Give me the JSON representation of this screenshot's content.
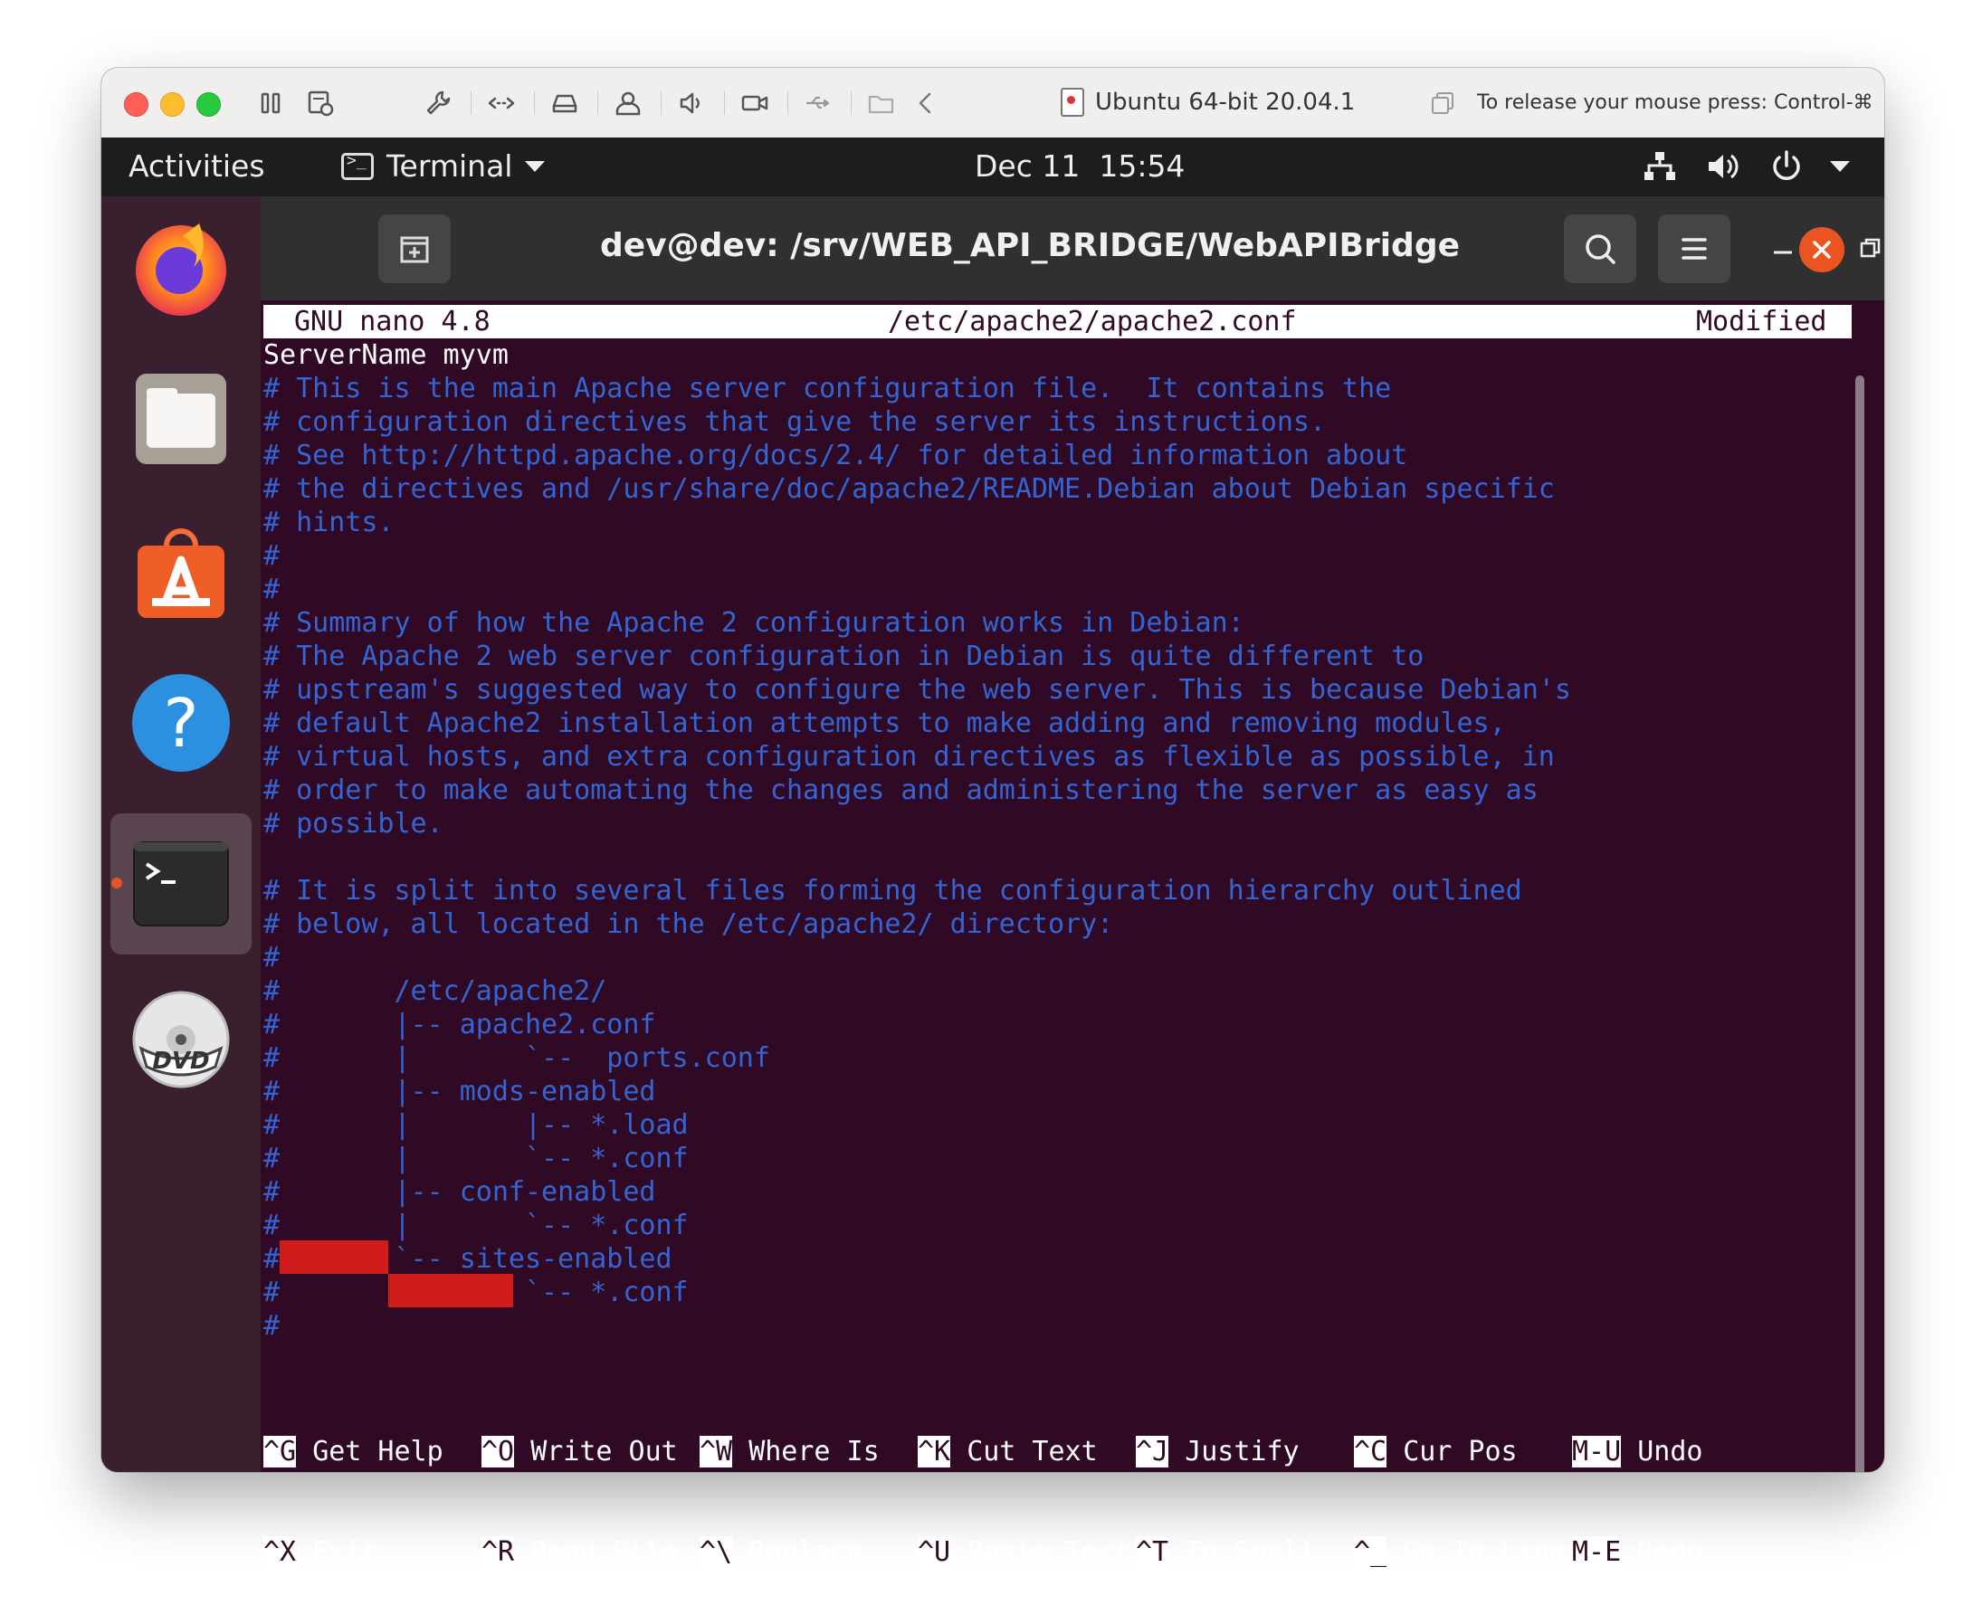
{
  "host": {
    "vm_title": "Ubuntu 64-bit 20.04.1",
    "release_hint": "To release your mouse press: Control-⌘",
    "toolbar_icons": [
      "pause-icon",
      "snapshot-icon",
      "settings-wrench-icon",
      "network-arrows-icon",
      "disk-icon",
      "user-icon",
      "speaker-icon",
      "camera-icon",
      "usb-icon",
      "shared-folder-icon",
      "back-arrow-icon"
    ]
  },
  "topbar": {
    "activities": "Activities",
    "app_name": "Terminal",
    "date": "Dec 11",
    "time": "15:54"
  },
  "dock": {
    "apps": [
      "firefox",
      "files",
      "ubuntu-software",
      "help",
      "terminal",
      "dvd"
    ],
    "active": "terminal"
  },
  "terminal": {
    "title": "dev@dev: /srv/WEB_API_BRIDGE/WebAPIBridge"
  },
  "nano": {
    "version": "GNU nano 4.8",
    "filename": "/etc/apache2/apache2.conf",
    "status": "Modified",
    "lines": [
      {
        "text": "ServerName myvm",
        "kind": "plain"
      },
      {
        "text": "# This is the main Apache server configuration file.  It contains the",
        "kind": "comment"
      },
      {
        "text": "# configuration directives that give the server its instructions.",
        "kind": "comment"
      },
      {
        "text": "# See http://httpd.apache.org/docs/2.4/ for detailed information about",
        "kind": "comment"
      },
      {
        "text": "# the directives and /usr/share/doc/apache2/README.Debian about Debian specific",
        "kind": "comment"
      },
      {
        "text": "# hints.",
        "kind": "comment"
      },
      {
        "text": "#",
        "kind": "comment"
      },
      {
        "text": "#",
        "kind": "comment"
      },
      {
        "text": "# Summary of how the Apache 2 configuration works in Debian:",
        "kind": "comment"
      },
      {
        "text": "# The Apache 2 web server configuration in Debian is quite different to",
        "kind": "comment"
      },
      {
        "text": "# upstream's suggested way to configure the web server. This is because Debian's",
        "kind": "comment"
      },
      {
        "text": "# default Apache2 installation attempts to make adding and removing modules,",
        "kind": "comment"
      },
      {
        "text": "# virtual hosts, and extra configuration directives as flexible as possible, in",
        "kind": "comment"
      },
      {
        "text": "# order to make automating the changes and administering the server as easy as",
        "kind": "comment"
      },
      {
        "text": "# possible.",
        "kind": "comment"
      },
      {
        "text": "",
        "kind": "comment"
      },
      {
        "text": "# It is split into several files forming the configuration hierarchy outlined",
        "kind": "comment"
      },
      {
        "text": "# below, all located in the /etc/apache2/ directory:",
        "kind": "comment"
      },
      {
        "text": "#",
        "kind": "comment"
      },
      {
        "text": "#       /etc/apache2/",
        "kind": "comment"
      },
      {
        "text": "#       |-- apache2.conf",
        "kind": "comment"
      },
      {
        "text": "#       |       `--  ports.conf",
        "kind": "comment"
      },
      {
        "text": "#       |-- mods-enabled",
        "kind": "comment"
      },
      {
        "text": "#       |       |-- *.load",
        "kind": "comment"
      },
      {
        "text": "#       |       `-- *.conf",
        "kind": "comment"
      },
      {
        "text": "#       |-- conf-enabled",
        "kind": "comment"
      },
      {
        "text": "#       |       `-- *.conf",
        "kind": "comment"
      },
      {
        "text": "#       `-- sites-enabled",
        "kind": "comment"
      },
      {
        "text": "#               `-- *.conf",
        "kind": "comment"
      },
      {
        "text": "#",
        "kind": "comment"
      }
    ],
    "shortcuts_row1": [
      {
        "key": "^G",
        "label": "Get Help"
      },
      {
        "key": "^O",
        "label": "Write Out"
      },
      {
        "key": "^W",
        "label": "Where Is"
      },
      {
        "key": "^K",
        "label": "Cut Text"
      },
      {
        "key": "^J",
        "label": "Justify"
      },
      {
        "key": "^C",
        "label": "Cur Pos"
      },
      {
        "key": "M-U",
        "label": "Undo"
      }
    ],
    "shortcuts_row2": [
      {
        "key": "^X",
        "label": "Exit"
      },
      {
        "key": "^R",
        "label": "Read File"
      },
      {
        "key": "^\\",
        "label": "Replace"
      },
      {
        "key": "^U",
        "label": "Paste Text"
      },
      {
        "key": "^T",
        "label": "To Spell"
      },
      {
        "key": "^_",
        "label": "Go To Line"
      },
      {
        "key": "M-E",
        "label": "Redo"
      }
    ]
  },
  "colors": {
    "terminal_bg": "#300a24",
    "comment": "#3465d4",
    "accent": "#e95420",
    "redaction": "#d11b1b"
  }
}
